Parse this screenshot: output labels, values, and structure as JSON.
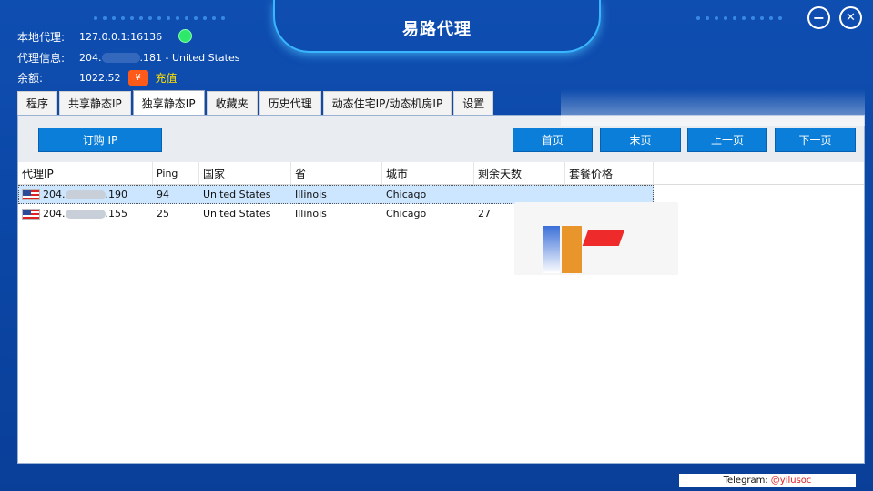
{
  "app": {
    "title": "易路代理"
  },
  "window_controls": {
    "minimize": "−",
    "close": "✕"
  },
  "info": {
    "local_proxy_label": "本地代理:",
    "local_proxy_value": "127.0.0.1:16136",
    "proxy_info_label": "代理信息:",
    "proxy_info_prefix": "204.",
    "proxy_info_suffix": ".181 - United States",
    "balance_label": "余额:",
    "balance_value": "1022.52",
    "yen_icon": "¥",
    "recharge_label": "充值"
  },
  "tabs": [
    {
      "label": "程序",
      "active": false
    },
    {
      "label": "共享静态IP",
      "active": false
    },
    {
      "label": "独享静态IP",
      "active": true
    },
    {
      "label": "收藏夹",
      "active": false
    },
    {
      "label": "历史代理",
      "active": false
    },
    {
      "label": "动态住宅IP/动态机房IP",
      "active": false
    },
    {
      "label": "设置",
      "active": false
    }
  ],
  "toolbar": {
    "buy_ip": "订购 IP",
    "first_page": "首页",
    "last_page": "末页",
    "prev_page": "上一页",
    "next_page": "下一页"
  },
  "table": {
    "columns": [
      "代理IP",
      "Ping",
      "国家",
      "省",
      "城市",
      "剩余天数",
      "套餐价格"
    ],
    "rows": [
      {
        "ip_prefix": "204.",
        "ip_suffix": ".190",
        "ping": "94",
        "country": "United States",
        "province": "Illinois",
        "city": "Chicago",
        "days_left": "",
        "price": "",
        "selected": true
      },
      {
        "ip_prefix": "204.",
        "ip_suffix": ".155",
        "ping": "25",
        "country": "United States",
        "province": "Illinois",
        "city": "Chicago",
        "days_left": "27",
        "price": "",
        "selected": false
      }
    ]
  },
  "footer": {
    "telegram_label": "Telegram:",
    "telegram_handle": "@yilusoc"
  },
  "colors": {
    "background": "#0b47a6",
    "accent_button": "#0a7ed8",
    "status_online": "#2ee86a",
    "recharge": "#ffe000",
    "badge": "#ff5a1a"
  }
}
